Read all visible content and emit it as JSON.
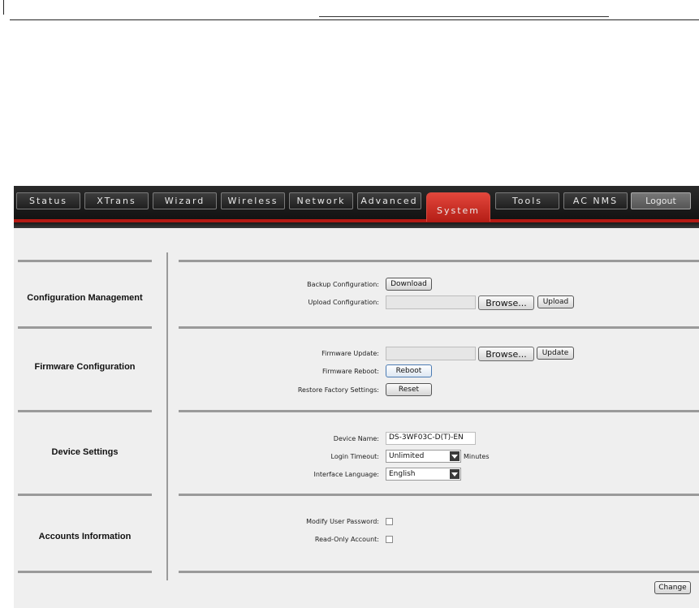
{
  "nav": {
    "tabs": [
      {
        "label": "Status"
      },
      {
        "label": "XTrans"
      },
      {
        "label": "Wizard"
      },
      {
        "label": "Wireless"
      },
      {
        "label": "Network"
      },
      {
        "label": "Advanced"
      },
      {
        "label": "System"
      },
      {
        "label": "Tools"
      },
      {
        "label": "AC NMS"
      }
    ],
    "active_tab": "System",
    "logout_label": "Logout",
    "accent_color": "#c8281e"
  },
  "sections": {
    "config": {
      "title": "Configuration Management",
      "backup_label": "Backup Configuration:",
      "download_label": "Download",
      "upload_label": "Upload Configuration:",
      "browse_label": "Browse...",
      "upload_button": "Upload"
    },
    "firmware": {
      "title": "Firmware Configuration",
      "update_label": "Firmware Update:",
      "browse_label": "Browse...",
      "update_button": "Update",
      "reboot_label": "Firmware Reboot:",
      "reboot_button": "Reboot",
      "restore_label": "Restore Factory Settings:",
      "reset_button": "Reset"
    },
    "device": {
      "title": "Device Settings",
      "name_label": "Device Name:",
      "name_value": "DS-3WF03C-D(T)-EN",
      "timeout_label": "Login Timeout:",
      "timeout_value": "Unlimited",
      "timeout_unit": "Minutes",
      "language_label": "Interface Language:",
      "language_value": "English"
    },
    "accounts": {
      "title": "Accounts Information",
      "modify_label": "Modify User Password:",
      "readonly_label": "Read-Only Account:"
    }
  },
  "footer": {
    "change_button": "Change"
  }
}
